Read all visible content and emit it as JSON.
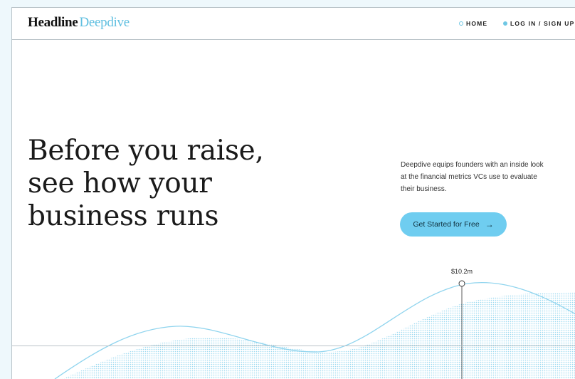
{
  "header": {
    "logo_primary": "Headline",
    "logo_secondary": "Deepdive",
    "nav": [
      {
        "label": "HOME"
      },
      {
        "label": "LOG IN / SIGN UP"
      }
    ]
  },
  "hero": {
    "headline_lines": [
      "Before you raise,",
      "see how your",
      "business runs"
    ],
    "description": "Deepdive equips founders with an inside look at the financial metrics VCs use to evaluate their business.",
    "cta_label": "Get Started for Free",
    "cta_icon": "arrow-right-icon"
  },
  "chart": {
    "highlight_value": "$10.2m"
  },
  "colors": {
    "accent": "#6fcdf0",
    "logo_light": "#5fbfe0",
    "line": "#8fd4ee",
    "text": "#1a1a1a",
    "border": "#b9c3c8",
    "page_bg": "#eef8fc"
  }
}
